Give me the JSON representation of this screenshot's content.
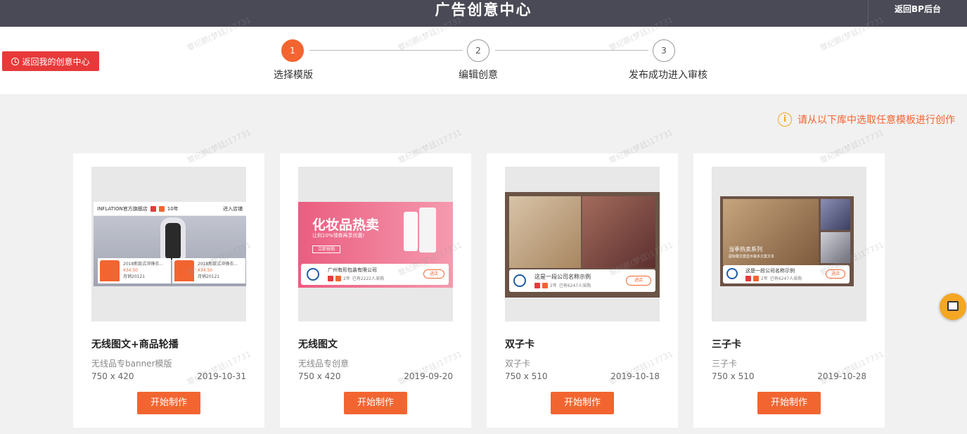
{
  "header": {
    "title": "广告创意中心",
    "back_bp_label": "返回BP后台"
  },
  "back_button": {
    "label": "返回我的创意中心"
  },
  "steps": [
    {
      "number": "1",
      "label": "选择模版",
      "active": true
    },
    {
      "number": "2",
      "label": "编辑创意",
      "active": false
    },
    {
      "number": "3",
      "label": "发布成功进入审核",
      "active": false
    }
  ],
  "hint": {
    "text": "请从以下库中选取任意模板进行创作",
    "icon": "info-icon"
  },
  "watermark": "覃纪鹏(梦廷)17731",
  "templates": [
    {
      "name": "无线图文+商品轮播",
      "desc": "无线品专banner模版",
      "size": "750 x 420",
      "date": "2019-10-31",
      "button": "开始制作"
    },
    {
      "name": "无线图文",
      "desc": "无线品专创意",
      "size": "750 x 420",
      "date": "2019-09-20",
      "button": "开始制作"
    },
    {
      "name": "双子卡",
      "desc": "双子卡",
      "size": "750 x 510",
      "date": "2019-10-18",
      "button": "开始制作"
    },
    {
      "name": "三子卡",
      "desc": "三子卡",
      "size": "750 x 510",
      "date": "2019-10-28",
      "button": "开始制作"
    }
  ],
  "previews": {
    "p1": {
      "shop": "INFLATION官方旗舰店",
      "years": "10年",
      "enter": "进入店铺",
      "prod_name": "2018新款式冲锋衣...",
      "price": "¥34.50",
      "sold": "月销20121"
    },
    "p2": {
      "headline": "化妆品热卖",
      "sub": "让利10%领券再享优惠!",
      "cta": "立即抢购",
      "company": "广州有形包装有限公司",
      "years": "2年",
      "buyers": "已有2222人采购",
      "enter": "进店"
    },
    "p3": {
      "company": "这是一段公司名称示例",
      "years": "2年",
      "buyers": "已有6247人采购",
      "enter": "进店"
    },
    "p4": {
      "series": "当季热卖系列",
      "sub": "副标题文案显示最多文案文本",
      "company": "这是一段公司名称示例",
      "years": "2年",
      "buyers": "已有6247人采购",
      "enter": "进店"
    }
  },
  "colors": {
    "accent": "#f26531",
    "header_bg": "#4a4a56",
    "back_btn": "#e8393a"
  }
}
